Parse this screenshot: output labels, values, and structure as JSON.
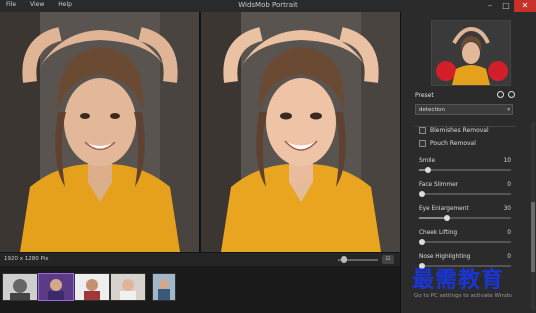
{
  "window": {
    "title": "WidsMob Portrait",
    "menu": [
      "File",
      "View",
      "Help"
    ],
    "controls": {
      "minimize": "–",
      "maximize": "□",
      "close": "✕"
    }
  },
  "viewer": {
    "dimensions_text": "1920 x 1280 Pix",
    "fit_button": "⊡",
    "zoom_level": 0.1
  },
  "filmstrip": {
    "thumbnails": [
      {
        "name": "thumb-1",
        "selected": false
      },
      {
        "name": "thumb-2",
        "selected": true
      },
      {
        "name": "thumb-3",
        "selected": false
      },
      {
        "name": "thumb-4",
        "selected": false
      },
      {
        "name": "thumb-5",
        "selected": false
      }
    ]
  },
  "panel": {
    "preset_label": "Preset",
    "preset_value": "detection",
    "checkboxes": [
      {
        "label": "Blemishes Removal",
        "checked": false
      },
      {
        "label": "Pouch Removal",
        "checked": false
      }
    ],
    "sliders": [
      {
        "label": "Smile",
        "value": "10",
        "fraction": 0.1
      },
      {
        "label": "Face Slimmer",
        "value": "0",
        "fraction": 0.0
      },
      {
        "label": "Eye Enlargement",
        "value": "30",
        "fraction": 0.3
      },
      {
        "label": "Cheek Lifting",
        "value": "0",
        "fraction": 0.0
      },
      {
        "label": "Nose Highlighting",
        "value": "0",
        "fraction": 0.0
      }
    ]
  },
  "overlay": {
    "watermark": "最需教育",
    "activate_text": "Go to PC settings to activate Windo"
  },
  "colors": {
    "accent": "#9a6be0",
    "close": "#c8302a",
    "watermark": "#1a35d6"
  }
}
